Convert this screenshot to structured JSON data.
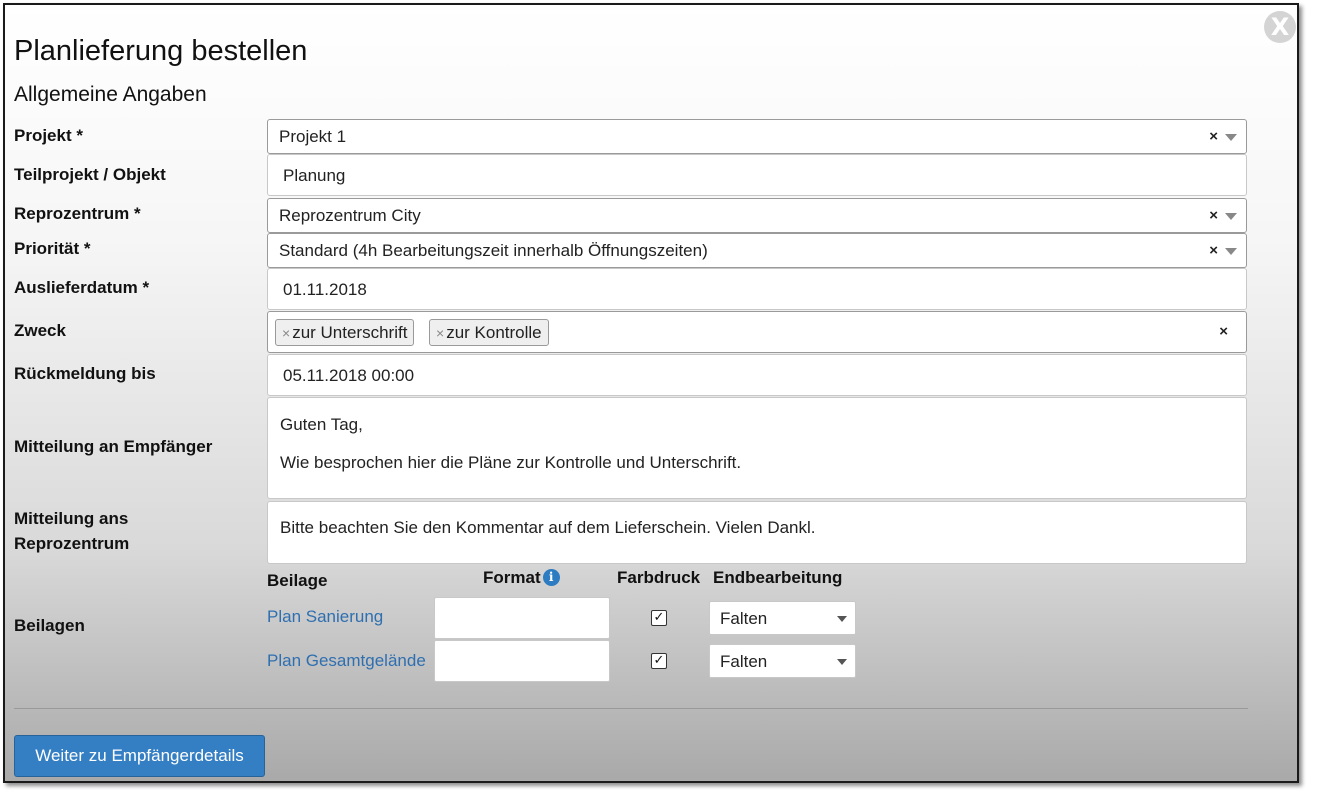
{
  "dialog": {
    "title": "Planlieferung bestellen",
    "subtitle": "Allgemeine Angaben",
    "close_label": "X"
  },
  "form": {
    "projekt": {
      "label": "Projekt *",
      "value": "Projekt 1",
      "clear": "×"
    },
    "teilprojekt": {
      "label": "Teilprojekt / Objekt",
      "value": "Planung"
    },
    "reprozentrum": {
      "label": "Reprozentrum *",
      "value": "Reprozentrum City",
      "clear": "×"
    },
    "prioritaet": {
      "label": "Priorität *",
      "value": "Standard (4h Bearbeitungszeit innerhalb Öffnungszeiten)",
      "clear": "×"
    },
    "auslieferdatum": {
      "label": "Auslieferdatum *",
      "value": "01.11.2018"
    },
    "zweck": {
      "label": "Zweck",
      "tags": [
        {
          "remove": "×",
          "text": "zur Unterschrift"
        },
        {
          "remove": "×",
          "text": "zur Kontrolle"
        }
      ],
      "clear": "×"
    },
    "rueckmeldung": {
      "label": "Rückmeldung bis",
      "value": "05.11.2018 00:00"
    },
    "mitteilung_empfaenger": {
      "label": "Mitteilung an Empfänger",
      "line1": "Guten Tag,",
      "line2": "Wie besprochen hier die Pläne zur Kontrolle und Unterschrift."
    },
    "mitteilung_repro": {
      "label_line1": "Mitteilung ans",
      "label_line2": "Reprozentrum",
      "value": "Bitte beachten Sie den Kommentar auf dem Lieferschein. Vielen Dankl."
    }
  },
  "beilagen": {
    "label": "Beilagen",
    "headers": {
      "beilage": "Beilage",
      "format": "Format",
      "farbdruck": "Farbdruck",
      "endbearbeitung": "Endbearbeitung"
    },
    "info_glyph": "i",
    "rows": [
      {
        "name": "Plan Sanierung",
        "format": "",
        "farbdruck": "✓",
        "endbearbeitung": "Falten"
      },
      {
        "name": "Plan Gesamtgelände",
        "format": "",
        "farbdruck": "✓",
        "endbearbeitung": "Falten"
      }
    ]
  },
  "footer": {
    "next_button": "Weiter zu Empfängerdetails"
  },
  "icons": {
    "close": "close-icon",
    "info": "info-icon",
    "caret": "chevron-down-icon"
  },
  "colors": {
    "primary": "#347ec3",
    "link": "#2f6fb0",
    "info": "#2d7cc1"
  }
}
